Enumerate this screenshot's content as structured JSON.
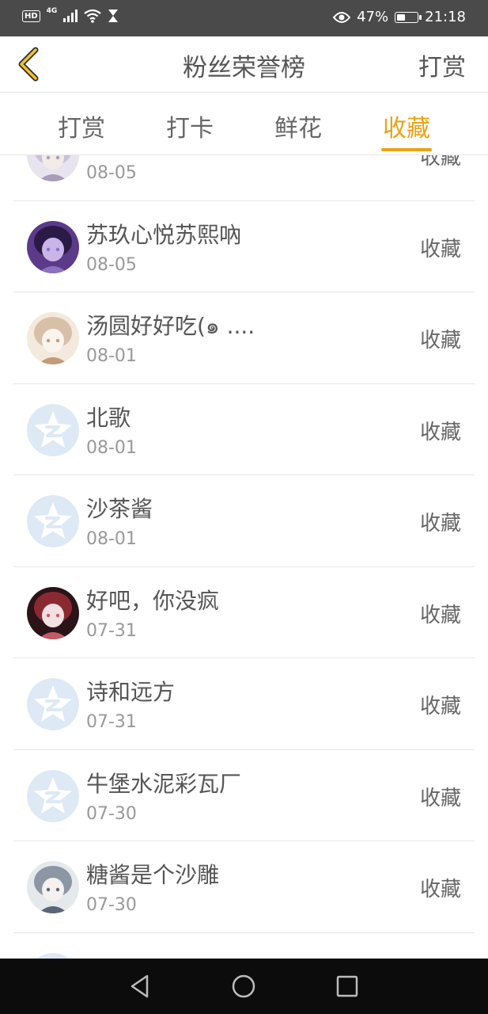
{
  "status_bar": {
    "hd": "HD",
    "network": "4G",
    "battery_percent": "47%",
    "battery_level": 0.47,
    "time": "21:18"
  },
  "header": {
    "title": "粉丝荣誉榜",
    "action_label": "打赏"
  },
  "tabs": [
    {
      "label": "打赏",
      "active": false
    },
    {
      "label": "打卡",
      "active": false
    },
    {
      "label": "鲜花",
      "active": false
    },
    {
      "label": "收藏",
      "active": true
    }
  ],
  "rows": [
    {
      "name": "",
      "date": "08-05",
      "action": "收藏",
      "avatar": "anime-avatar-light"
    },
    {
      "name": "苏玖心悦苏熙吶",
      "date": "08-05",
      "action": "收藏",
      "avatar": "anime-avatar-purple"
    },
    {
      "name": "汤圆好好吃(๑ ....",
      "date": "08-01",
      "action": "收藏",
      "avatar": "anime-avatar-beige"
    },
    {
      "name": "北歌",
      "date": "08-01",
      "action": "收藏",
      "avatar": "default-star-avatar"
    },
    {
      "name": "沙茶酱",
      "date": "08-01",
      "action": "收藏",
      "avatar": "default-star-avatar"
    },
    {
      "name": "好吧，你没疯",
      "date": "07-31",
      "action": "收藏",
      "avatar": "anime-avatar-dark"
    },
    {
      "name": "诗和远方",
      "date": "07-31",
      "action": "收藏",
      "avatar": "default-star-avatar"
    },
    {
      "name": "牛堡水泥彩瓦厂",
      "date": "07-30",
      "action": "收藏",
      "avatar": "default-star-avatar"
    },
    {
      "name": "糖酱是个沙雕",
      "date": "07-30",
      "action": "收藏",
      "avatar": "anime-avatar-grey"
    },
    {
      "name": "",
      "date": "",
      "action": "",
      "avatar": "default-star-avatar"
    }
  ],
  "colors": {
    "accent": "#e8a317",
    "status_bar": "#4a4a4a",
    "nav_bar": "#0c0c0c",
    "default_avatar_bg": "#dde9f5"
  }
}
